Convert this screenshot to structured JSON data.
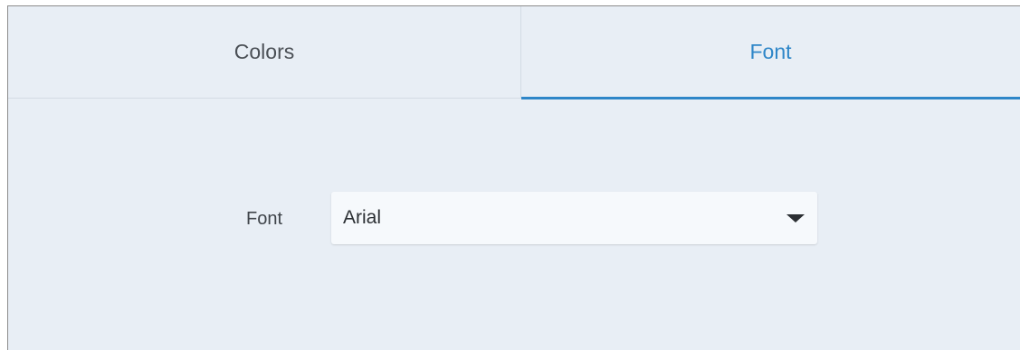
{
  "tabs": [
    {
      "label": "Colors",
      "active": false
    },
    {
      "label": "Font",
      "active": true
    }
  ],
  "font_field": {
    "label": "Font",
    "value": "Arial",
    "icon": "chevron-down-icon"
  },
  "colors": {
    "accent": "#2e86c8",
    "panel_background": "#e8eef5"
  }
}
